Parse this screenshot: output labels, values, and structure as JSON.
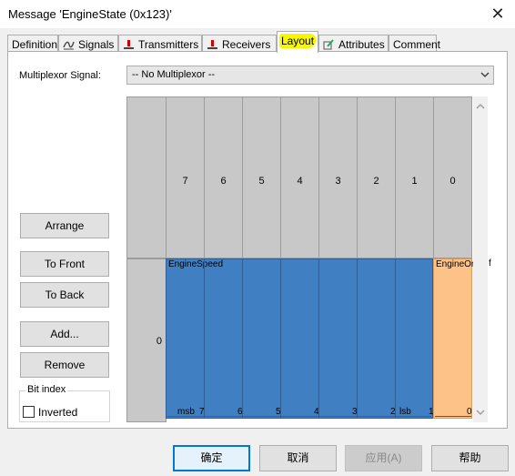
{
  "window": {
    "title": "Message 'EngineState (0x123)'",
    "close_glyph": "✕"
  },
  "tabs": [
    {
      "label": "Definition",
      "icon": ""
    },
    {
      "label": "Signals",
      "icon": "signals-icon"
    },
    {
      "label": "Transmitters",
      "icon": "transmitter-icon"
    },
    {
      "label": "Receivers",
      "icon": "receiver-icon"
    },
    {
      "label": "Layout",
      "icon": "",
      "active": true
    },
    {
      "label": "Attributes",
      "icon": "attributes-icon"
    },
    {
      "label": "Comment",
      "icon": ""
    }
  ],
  "multiplexor": {
    "label": "Multiplexor Signal:",
    "value": "-- No Multiplexor --"
  },
  "layout_buttons": {
    "arrange": "Arrange",
    "to_front": "To Front",
    "to_back": "To Back",
    "add": "Add...",
    "remove": "Remove"
  },
  "bit_index": {
    "group_label": "Bit index",
    "inverted_label": "Inverted",
    "inverted_checked": false
  },
  "grid": {
    "bit_headers": [
      "7",
      "6",
      "5",
      "4",
      "3",
      "2",
      "1",
      "0"
    ],
    "row_labels": [
      "0"
    ],
    "signals": [
      {
        "name": "EngineSpeed",
        "color": "#3f7fc2"
      },
      {
        "name": "EngineOn",
        "color": "#fcc288"
      }
    ],
    "bottom_labels": {
      "msb": "msb",
      "lsb": "lsb",
      "b7": "7",
      "b6": "6",
      "b5": "5",
      "b4": "4",
      "b3": "3",
      "b2": "2",
      "b1": "1",
      "b0": "0"
    }
  },
  "dialog_buttons": {
    "ok": "确定",
    "cancel": "取消",
    "apply": "应用(A)",
    "help": "帮助"
  }
}
